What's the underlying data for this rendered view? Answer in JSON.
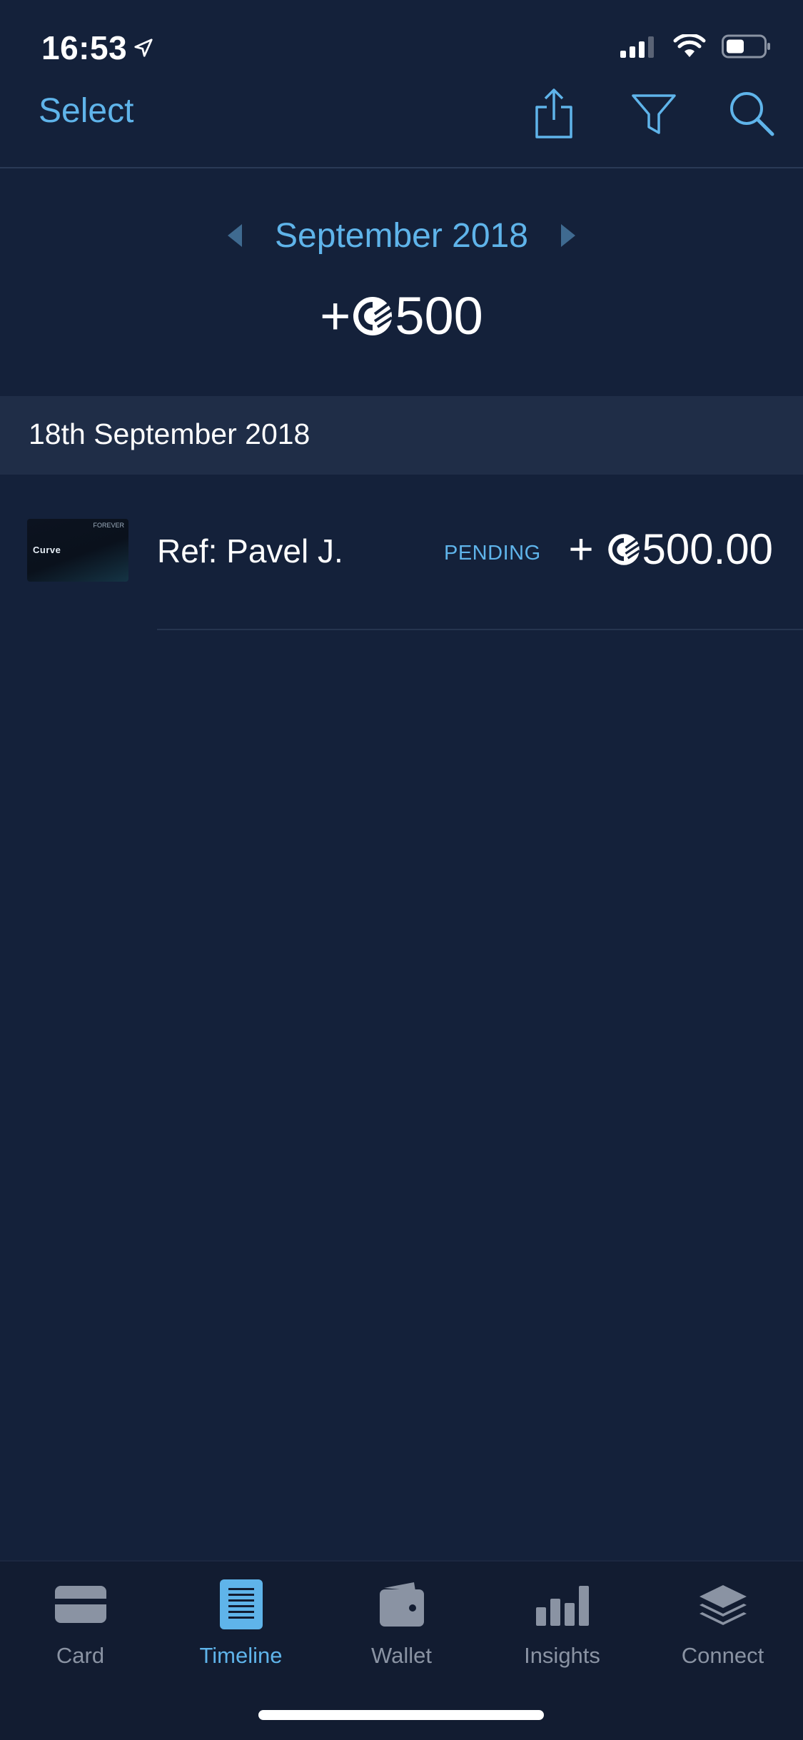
{
  "status_bar": {
    "time": "16:53"
  },
  "nav": {
    "select_label": "Select",
    "icons": [
      "share-icon",
      "filter-icon",
      "search-icon"
    ]
  },
  "period": {
    "label": "September 2018",
    "total_sign": "+",
    "total_value": "500"
  },
  "sections": [
    {
      "date": "18th September 2018",
      "transactions": [
        {
          "name": "Ref: Pavel J.",
          "status": "PENDING",
          "amount_sign": "+",
          "amount_value": "500.00",
          "card_brand": "Curve"
        }
      ]
    }
  ],
  "tabs": [
    {
      "label": "Card",
      "icon": "card-icon",
      "active": false
    },
    {
      "label": "Timeline",
      "icon": "timeline-icon",
      "active": true
    },
    {
      "label": "Wallet",
      "icon": "wallet-icon",
      "active": false
    },
    {
      "label": "Insights",
      "icon": "insights-icon",
      "active": false
    },
    {
      "label": "Connect",
      "icon": "connect-icon",
      "active": false
    }
  ],
  "colors": {
    "background": "#14213a",
    "accent": "#5fb4ea",
    "section_header": "#1f2d47",
    "tab_bar": "#121c31",
    "inactive_tab": "#8a93a3"
  }
}
